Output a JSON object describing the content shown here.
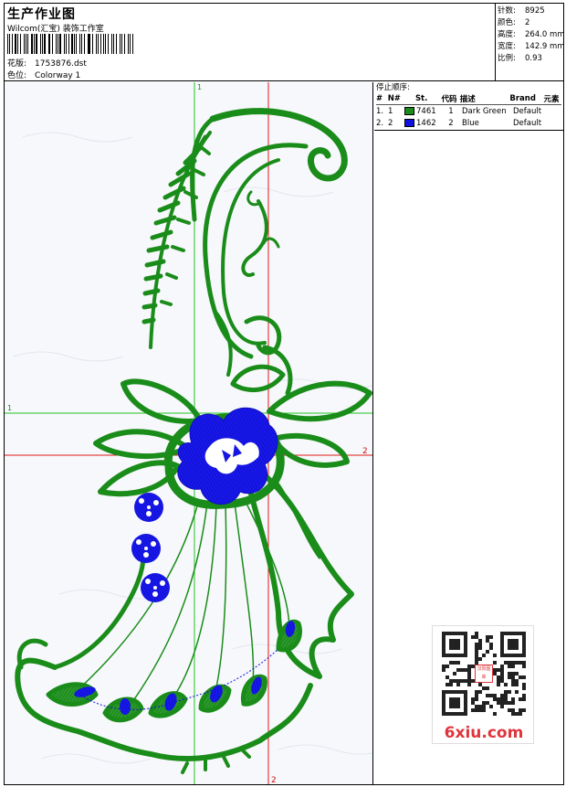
{
  "header": {
    "title": "生产作业图",
    "company": "Wilcom(汇宝) 装饰工作室",
    "design_label": "花版:",
    "design_value": "1753876.dst",
    "colorway_label": "色位:",
    "colorway_value": "Colorway 1"
  },
  "stats": {
    "stitches_label": "针数:",
    "stitches_value": "8925",
    "colors_label": "颜色:",
    "colors_value": "2",
    "height_label": "高度:",
    "height_value": "264.0 mm",
    "width_label": "宽度:",
    "width_value": "142.9 mm",
    "scale_label": "比例:",
    "scale_value": "0.93"
  },
  "stop_sequence": {
    "title": "停止顺序:",
    "headers": {
      "num": "#",
      "n": "N#",
      "stitches": "St.",
      "code": "代码",
      "desc": "描述",
      "brand": "Brand",
      "element": "元素"
    },
    "rows": [
      {
        "num": "1.",
        "n": "1",
        "color": "#1a8c1a",
        "stitches": "7461",
        "code": "1",
        "desc": "Dark Green",
        "brand": "Default"
      },
      {
        "num": "2.",
        "n": "2",
        "color": "#1010e0",
        "stitches": "1462",
        "code": "2",
        "desc": "Blue",
        "brand": "Default"
      }
    ]
  },
  "canvas": {
    "guide_labels": {
      "v_green": "1",
      "h_green": "1",
      "h_red": "2",
      "v_red": "2"
    },
    "thread_colors": {
      "green": "#1a8c1a",
      "blue": "#1010e0"
    }
  },
  "watermark": {
    "text": "6xiu.com",
    "qr_center_text": "汉阳图库"
  }
}
